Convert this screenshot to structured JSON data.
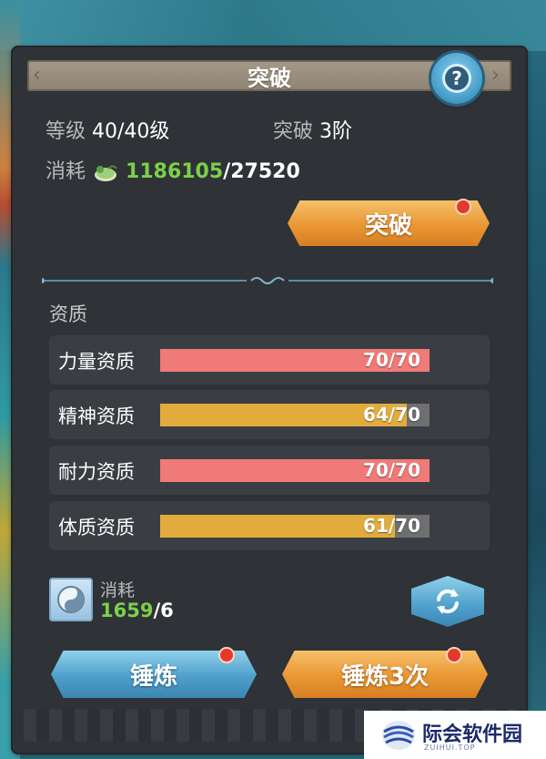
{
  "header": {
    "title": "突破"
  },
  "help": {
    "symbol": "?"
  },
  "level": {
    "label": "等级",
    "value": "40/40级"
  },
  "breakthrough_stage": {
    "label": "突破",
    "value": "3阶"
  },
  "breakthrough_cost": {
    "label": "消耗",
    "icon": "dragon-coin-icon",
    "have": "1186105",
    "need": "/27520"
  },
  "breakthrough_button": {
    "label": "突破",
    "has_notification": true
  },
  "aptitude": {
    "section_label": "资质",
    "items": [
      {
        "name": "力量资质",
        "current": 70,
        "max": 70,
        "text": "70/70",
        "color": "#f07a78"
      },
      {
        "name": "精神资质",
        "current": 64,
        "max": 70,
        "text": "64/70",
        "color": "#e2ac3c"
      },
      {
        "name": "耐力资质",
        "current": 70,
        "max": 70,
        "text": "70/70",
        "color": "#f07a78"
      },
      {
        "name": "体质资质",
        "current": 61,
        "max": 70,
        "text": "61/70",
        "color": "#e2ac3c"
      }
    ]
  },
  "refine_cost": {
    "label": "消耗",
    "icon": "yin-yang-orb-icon",
    "have": "1659",
    "need": "/6"
  },
  "buttons": {
    "refine": "锤炼",
    "refine_three": "锤炼3次"
  },
  "watermark": {
    "name": "际会软件园",
    "sub": "ZUIHUI.TOP"
  },
  "colors": {
    "panel": "#2f3236",
    "accent_green": "#7cd04a",
    "button_orange": "#e99733",
    "button_blue": "#4f9fcc",
    "notification_red": "#e23a2a"
  }
}
